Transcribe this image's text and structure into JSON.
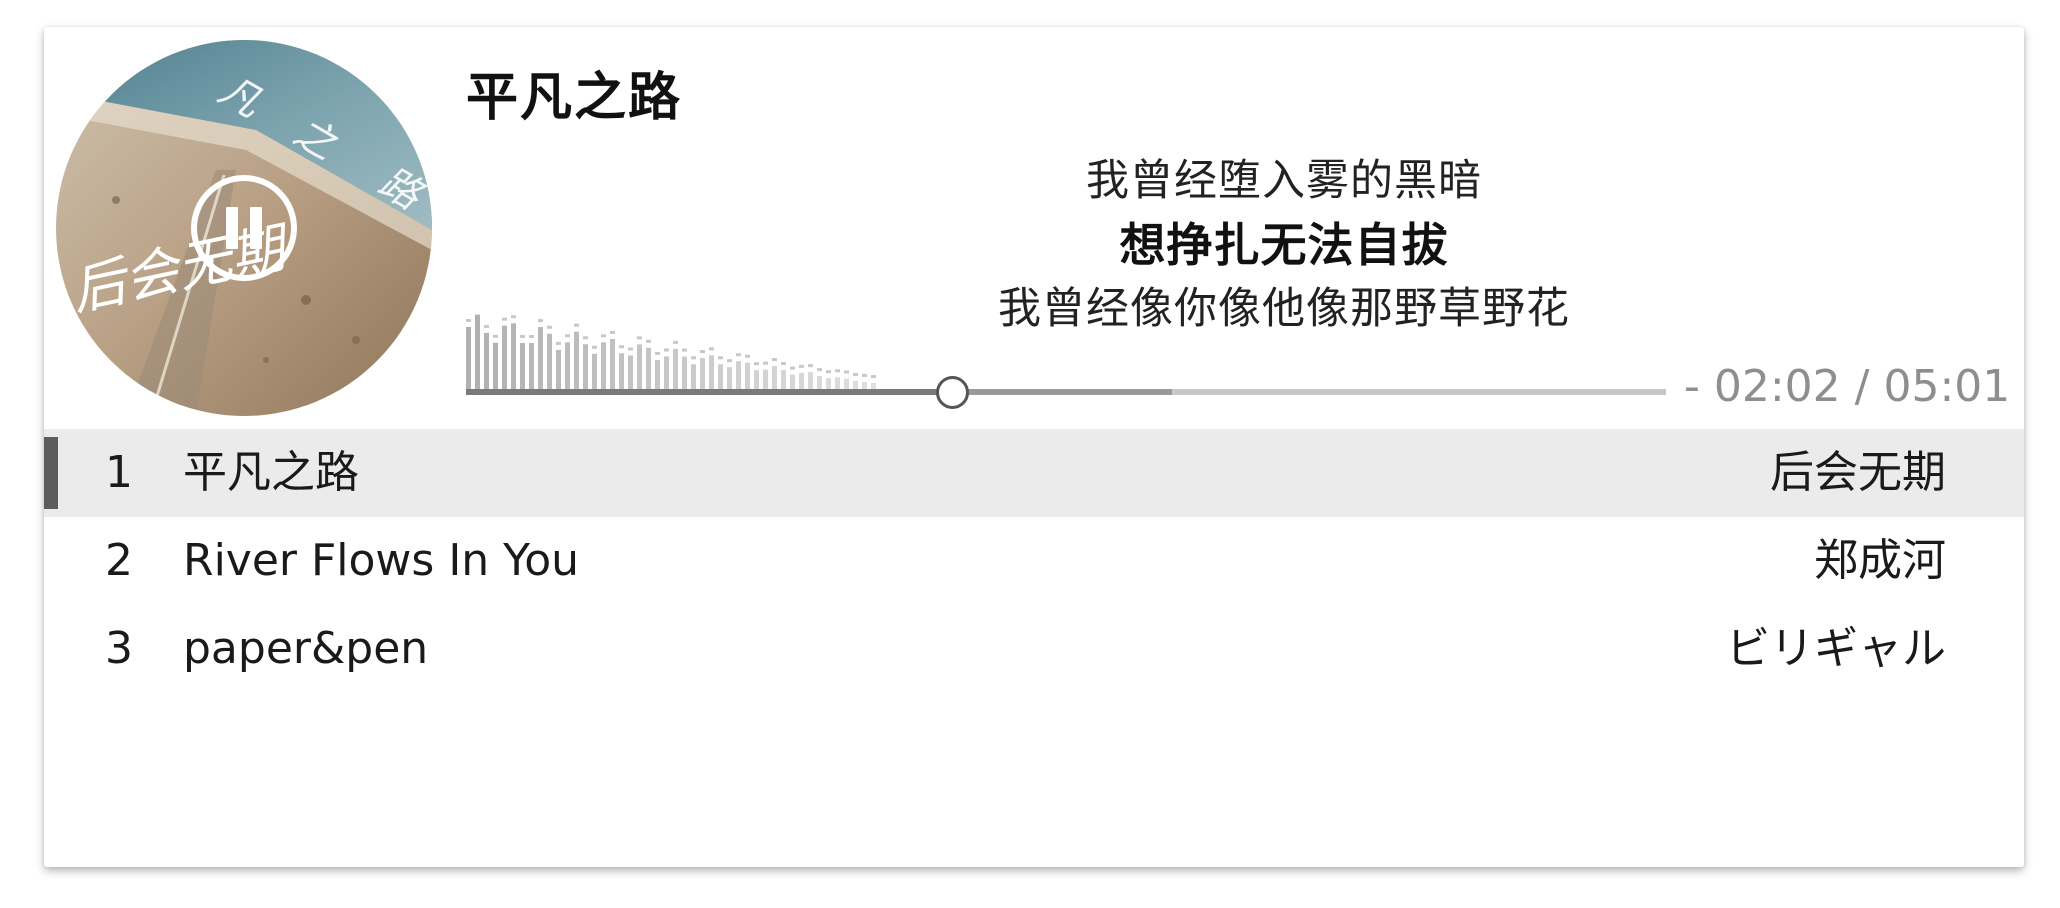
{
  "player": {
    "title": "平凡之路",
    "cover_text": "后会无期",
    "is_playing": true,
    "pause_icon": "pause-icon",
    "lyrics": {
      "previous": "我曾经堕入雾的黑暗",
      "current": "想挣扎无法自拔",
      "next": "我曾经像你像他像那野草野花"
    },
    "progress": {
      "played_fraction": 0.405,
      "buffered_fraction": 0.588,
      "time_display": "- 02:02 / 05:01"
    }
  },
  "playlist": {
    "active_index": 0,
    "items": [
      {
        "number": "1",
        "title": "平凡之路",
        "artist": "后会无期"
      },
      {
        "number": "2",
        "title": "River Flows In You",
        "artist": "郑成河"
      },
      {
        "number": "3",
        "title": "paper&pen",
        "artist": "ビリギャル"
      }
    ]
  },
  "colors": {
    "active_row_bg": "#ebebeb",
    "active_bar": "#5c5c5c",
    "progress_played": "#7a7a7a",
    "progress_track": "#c7c7c7",
    "time_text": "#8e8e8e"
  }
}
